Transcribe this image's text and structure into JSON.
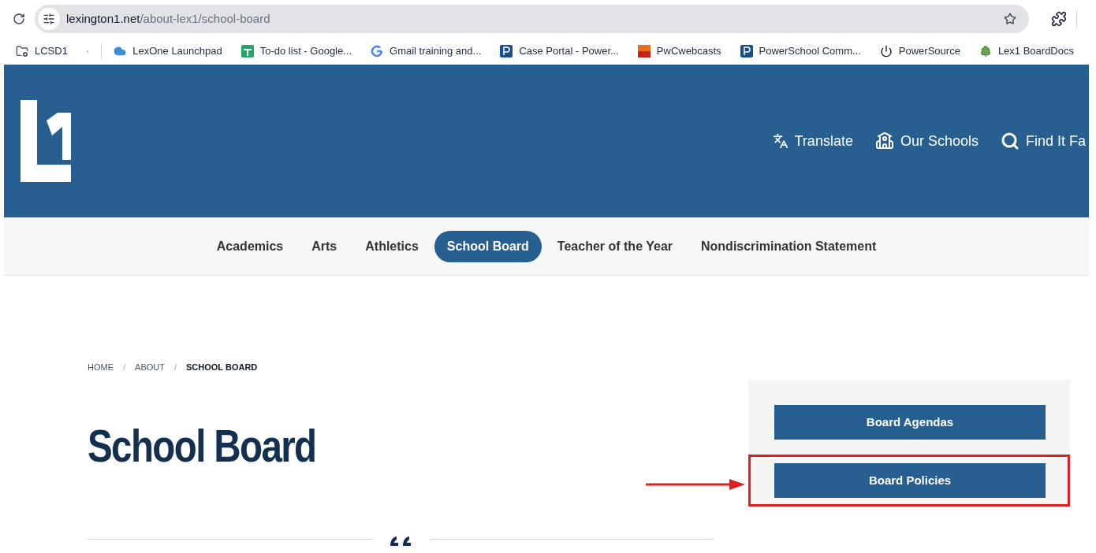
{
  "browser": {
    "url_host": "lexington1.net",
    "url_path": "/about-lex1/school-board"
  },
  "bookmarks": [
    {
      "label": "LCSD1",
      "kind": "folder"
    },
    {
      "kind": "apps"
    },
    {
      "label": "LexOne Launchpad",
      "kind": "cloud"
    },
    {
      "label": "To-do list - Google...",
      "kind": "sheets"
    },
    {
      "label": "Gmail training and...",
      "kind": "google"
    },
    {
      "label": "Case Portal - Power...",
      "kind": "powerschool"
    },
    {
      "label": "PwCwebcasts",
      "kind": "pwc"
    },
    {
      "label": "PowerSchool Comm...",
      "kind": "powerschool"
    },
    {
      "label": "PowerSource",
      "kind": "power"
    },
    {
      "label": "Lex1 BoardDocs",
      "kind": "tree"
    }
  ],
  "header_links": [
    {
      "label": "Translate",
      "kind": "translate"
    },
    {
      "label": "Our Schools",
      "kind": "school"
    },
    {
      "label": "Find It Fa",
      "kind": "search"
    }
  ],
  "subnav": [
    {
      "label": "Academics",
      "selected": false
    },
    {
      "label": "Arts",
      "selected": false
    },
    {
      "label": "Athletics",
      "selected": false
    },
    {
      "label": "School Board",
      "selected": true
    },
    {
      "label": "Teacher of the Year",
      "selected": false
    },
    {
      "label": "Nondiscrimination Statement",
      "selected": false
    }
  ],
  "breadcrumb": [
    {
      "label": "HOME",
      "kind": "link"
    },
    {
      "label": "/",
      "kind": "separator"
    },
    {
      "label": "ABOUT",
      "kind": "link"
    },
    {
      "label": "/",
      "kind": "separator"
    },
    {
      "label": "SCHOOL BOARD",
      "kind": "current"
    }
  ],
  "page_title": "School Board",
  "sidebar_buttons": [
    {
      "label": "Board Agendas",
      "highlighted": false
    },
    {
      "label": "Board Policies",
      "highlighted": true
    }
  ]
}
